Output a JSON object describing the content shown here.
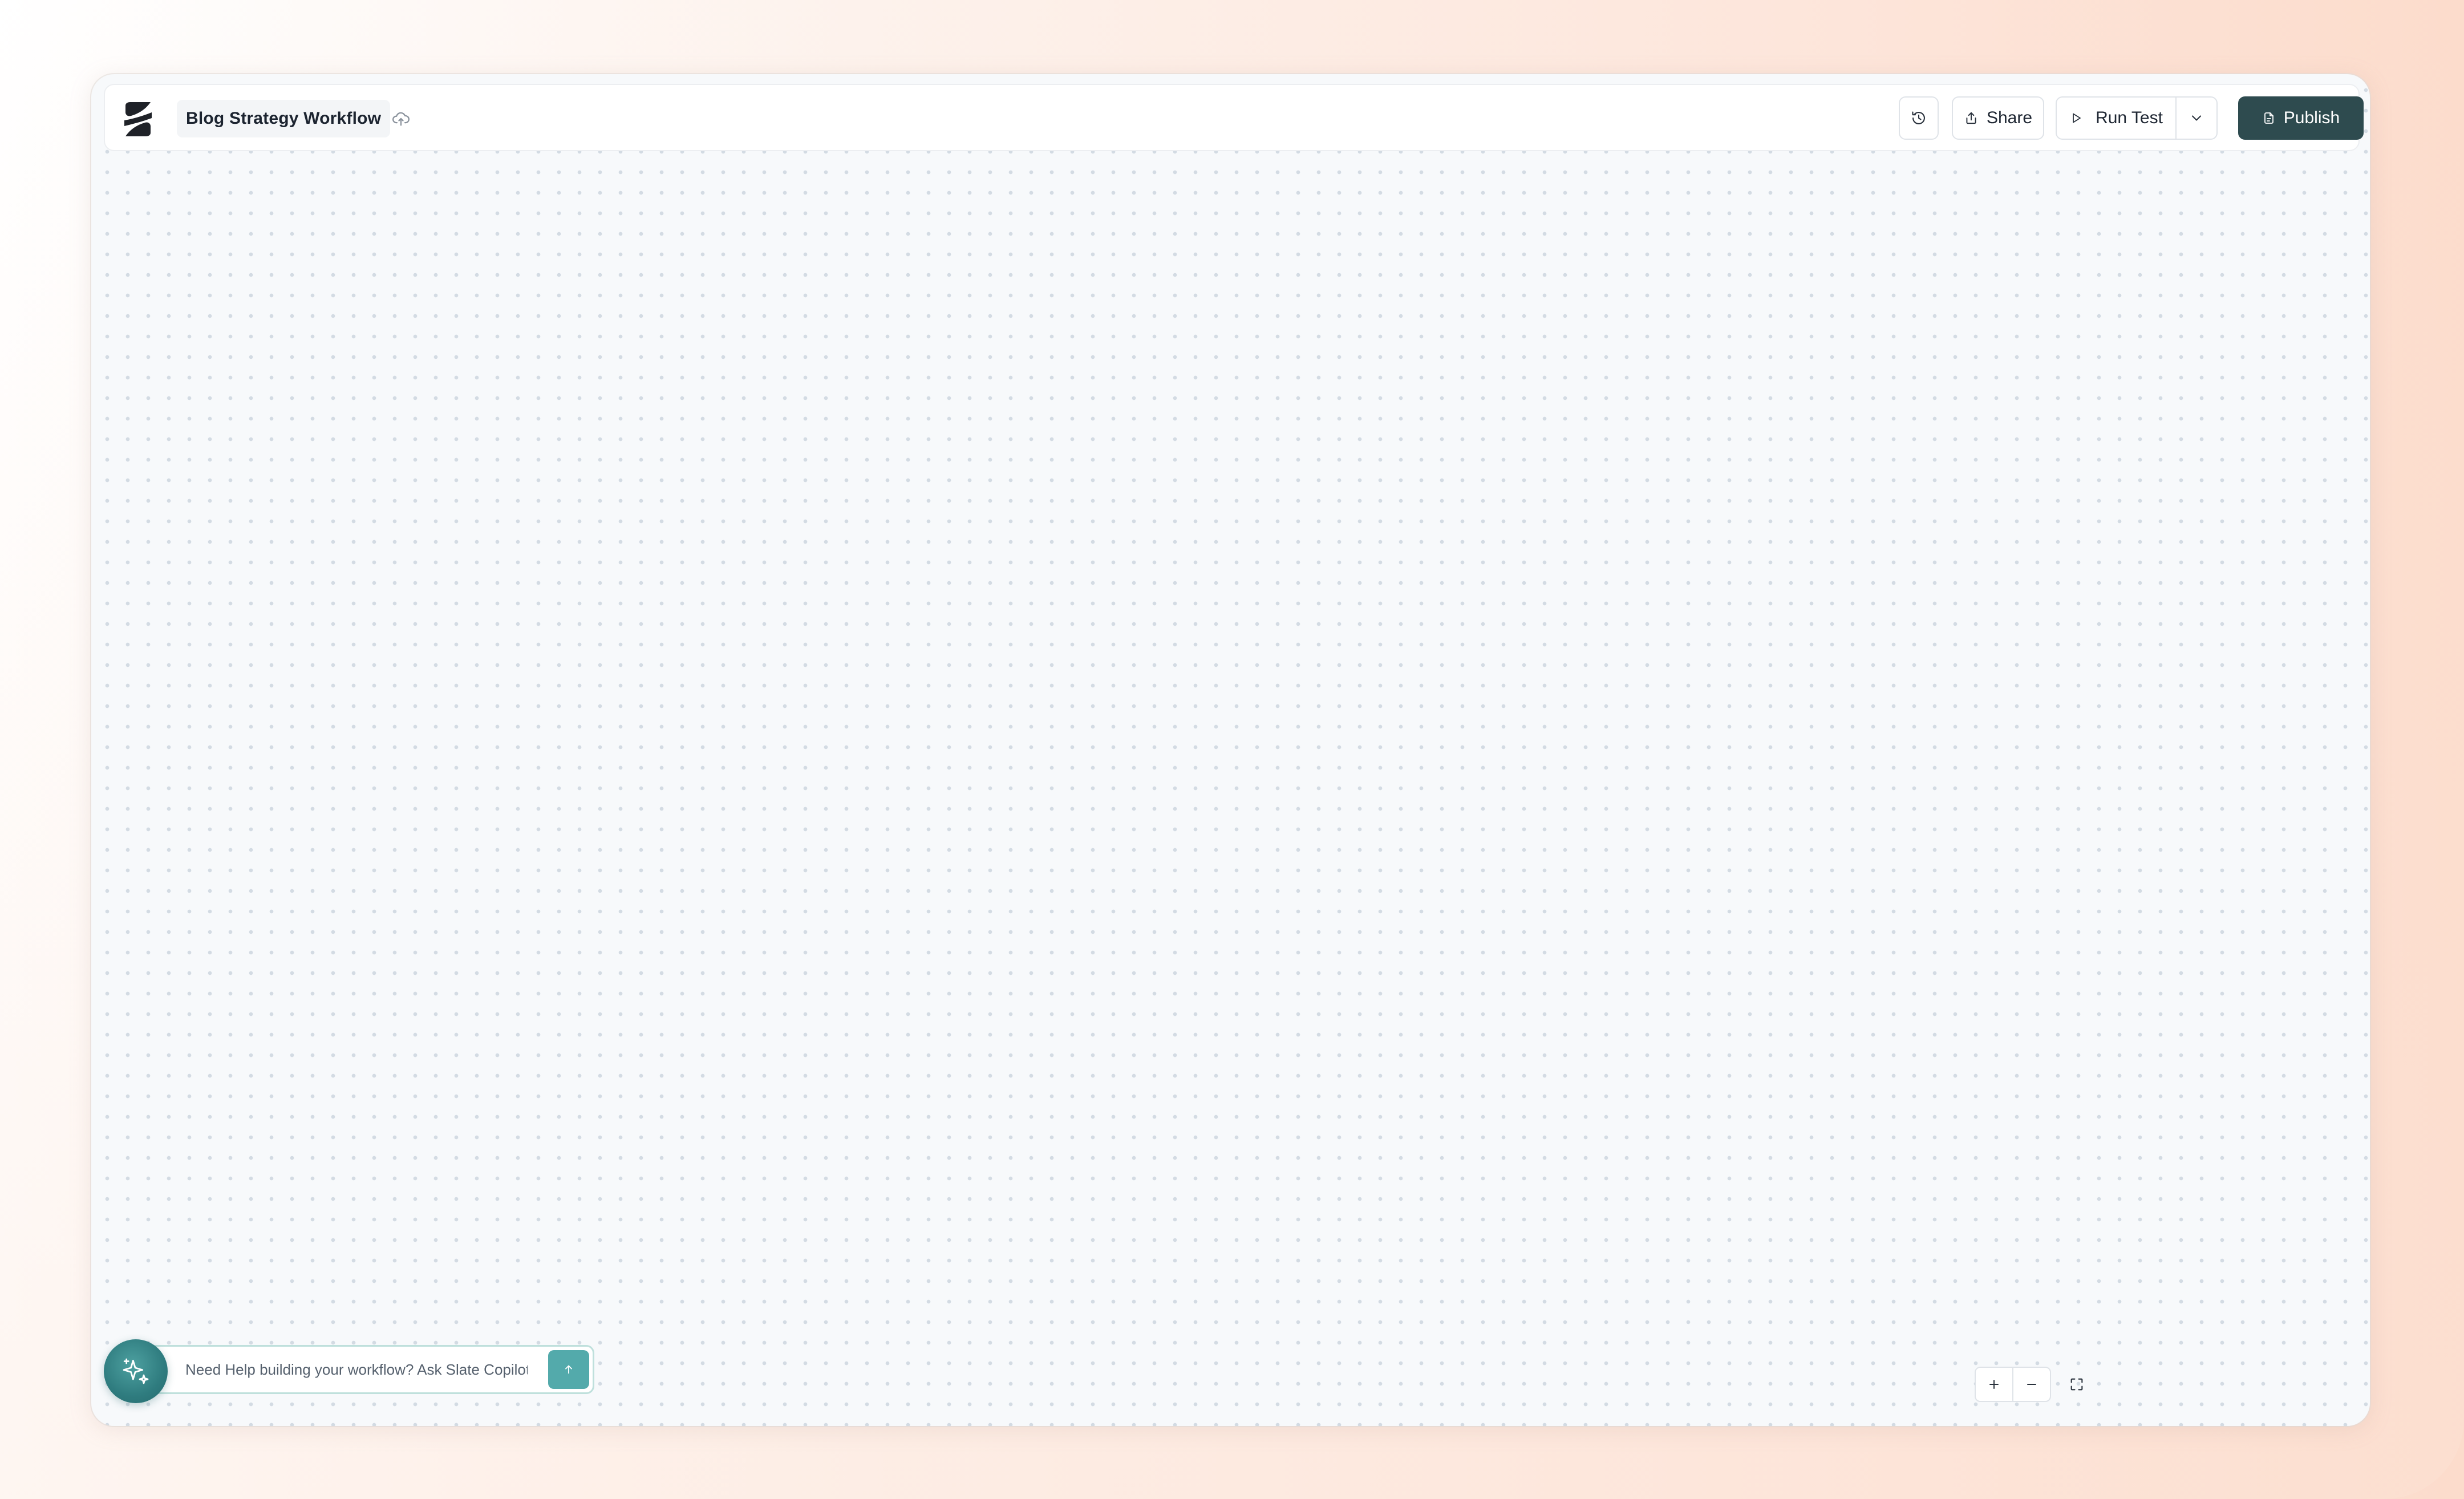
{
  "header": {
    "workflow_title": "Blog Strategy Workflow",
    "share_label": "Share",
    "run_test_label": "Run Test",
    "publish_label": "Publish"
  },
  "icons": {
    "logo": "slate-logo",
    "save_status": "cloud-upload-icon",
    "history": "history-icon",
    "share": "share-icon",
    "run": "play-icon",
    "dropdown": "chevron-down-icon",
    "publish": "document-icon",
    "copilot": "sparkles-icon",
    "send": "arrow-up-icon",
    "zoom_in": "plus-icon",
    "zoom_out": "minus-icon",
    "fit_view": "fullscreen-icon"
  },
  "copilot": {
    "placeholder": "Need Help building your workflow? Ask Slate Copilot!"
  },
  "colors": {
    "primary": "#2e4b4f",
    "accent": "#53aaab",
    "canvas": "#f7f9fb"
  }
}
